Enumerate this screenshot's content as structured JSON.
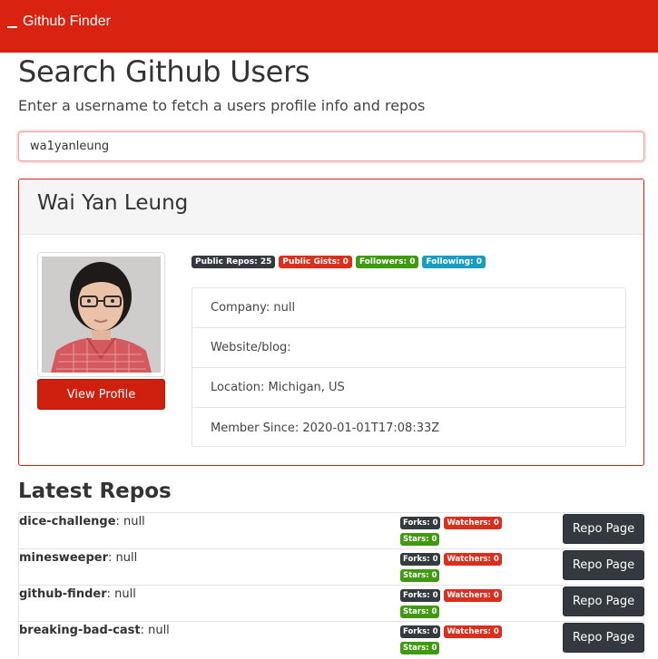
{
  "nav": {
    "brand": "Github Finder",
    "brand_icon": "menu-bar-icon"
  },
  "header": {
    "title": "Search Github Users",
    "subtitle": "Enter a username to fetch a users profile info and repos"
  },
  "search": {
    "value": "wa1yanleung",
    "placeholder": ""
  },
  "profile": {
    "name": "Wai Yan Leung",
    "view_profile_label": "View Profile",
    "badges": [
      {
        "label": "Public Repos: 25",
        "color": "#343a40"
      },
      {
        "label": "Public Gists: 0",
        "color": "#dc2e1c"
      },
      {
        "label": "Followers: 0",
        "color": "#3f9a0f"
      },
      {
        "label": "Following: 0",
        "color": "#1a9bc2"
      }
    ],
    "info": [
      "Company: null",
      "Website/blog:",
      "Location: Michigan, US",
      "Member Since: 2020-01-01T17:08:33Z"
    ]
  },
  "repos": {
    "title": "Latest Repos",
    "button_label": "Repo Page",
    "items": [
      {
        "name": "dice-challenge",
        "desc": ": null",
        "forks": "Forks: 0",
        "watchers": "Watchers: 0",
        "stars": "Stars: 0"
      },
      {
        "name": "minesweeper",
        "desc": ": null",
        "forks": "Forks: 0",
        "watchers": "Watchers: 0",
        "stars": "Stars: 0"
      },
      {
        "name": "github-finder",
        "desc": ": null",
        "forks": "Forks: 0",
        "watchers": "Watchers: 0",
        "stars": "Stars: 0"
      },
      {
        "name": "breaking-bad-cast",
        "desc": ": null",
        "forks": "Forks: 0",
        "watchers": "Watchers: 0",
        "stars": "Stars: 0"
      }
    ]
  },
  "colors": {
    "brand": "#d9220f",
    "dark": "#343a40",
    "danger": "#dc2e1c",
    "success": "#3f9a0f",
    "info": "#1a9bc2"
  }
}
